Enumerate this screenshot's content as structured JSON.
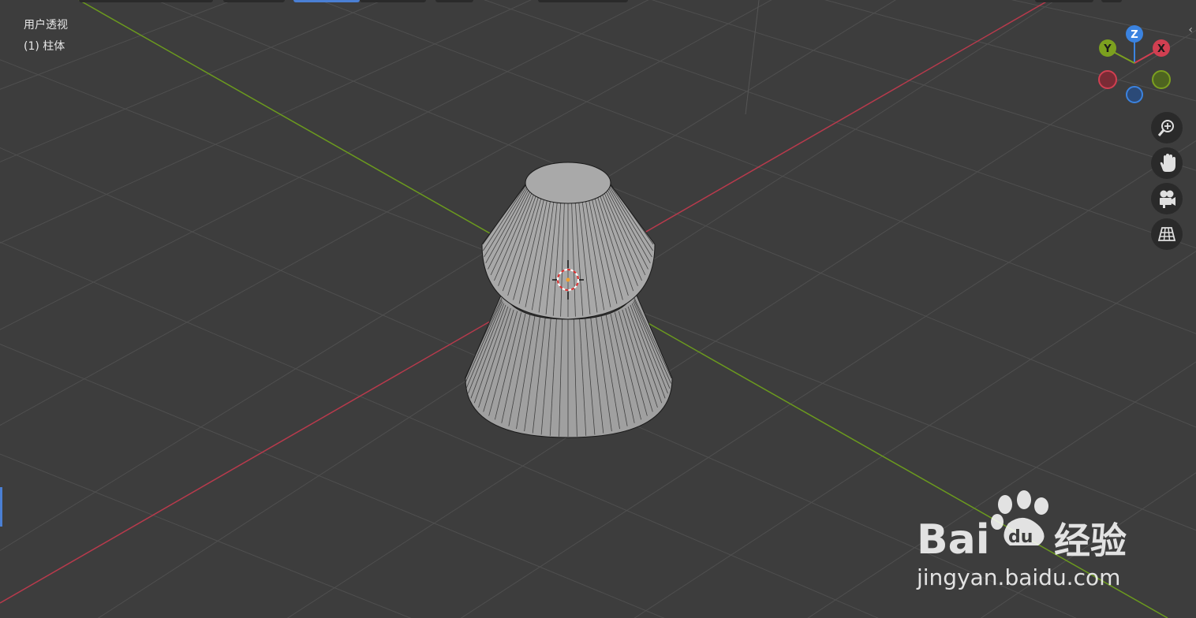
{
  "viewport": {
    "view_name": "用户透视",
    "active_object": "(1) 柱体",
    "colors": {
      "background": "#3d3d3d",
      "grid": "#4a4a4a",
      "x_axis": "#b83a4c",
      "y_axis": "#6b9a1e",
      "mesh_face": "#a0a0a0",
      "mesh_edge": "#1a1a1a"
    }
  },
  "gizmo": {
    "axes": [
      "X",
      "Y",
      "Z"
    ],
    "x_color": "#d13f51",
    "y_color": "#7ca01f",
    "z_color": "#3b83e0"
  },
  "nav_buttons": [
    "zoom-icon",
    "pan-hand-icon",
    "camera-icon",
    "ortho-grid-icon"
  ],
  "watermark": {
    "brand": "Bai",
    "brand_suffix": "du",
    "product": "经验",
    "url": "jingyan.baidu.com"
  }
}
